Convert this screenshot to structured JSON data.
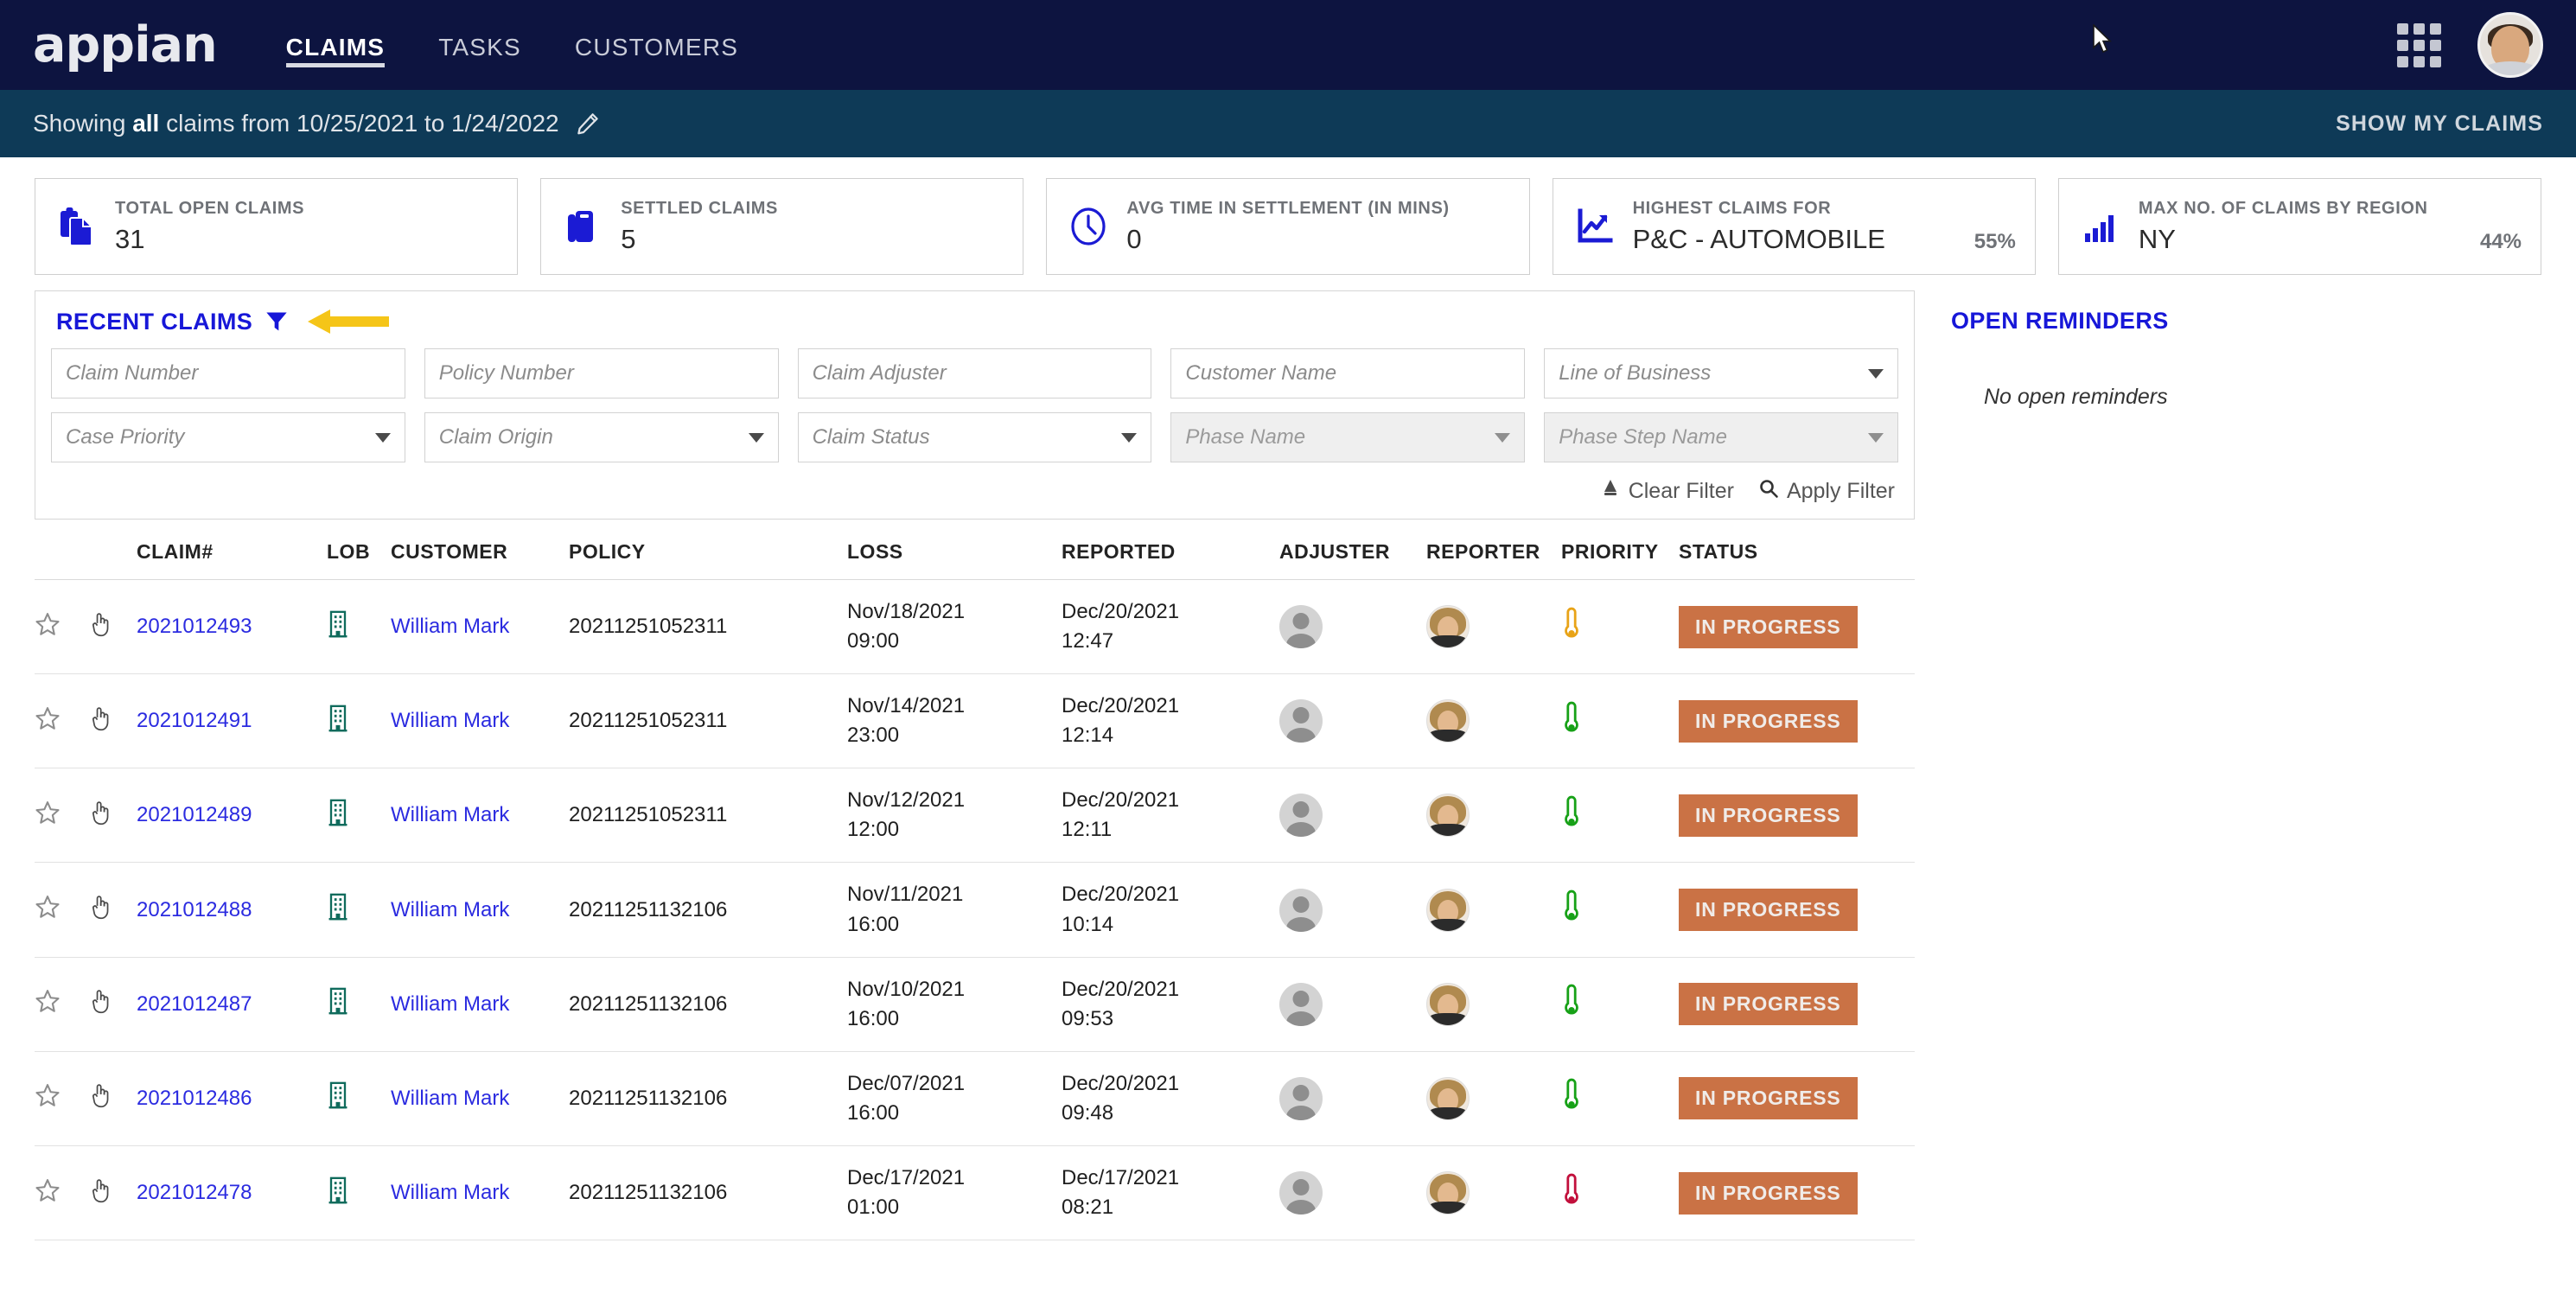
{
  "header": {
    "logo": "appian",
    "nav": [
      {
        "label": "CLAIMS",
        "active": true
      },
      {
        "label": "TASKS",
        "active": false
      },
      {
        "label": "CUSTOMERS",
        "active": false
      }
    ],
    "grid_icon": "apps-grid-icon",
    "avatar": "user-avatar"
  },
  "subheader": {
    "prefix": "Showing",
    "emphasis": "all",
    "suffix": "claims from 10/25/2021 to 1/24/2022",
    "edit_icon": "pencil-icon",
    "show_my_claims": "SHOW MY CLAIMS"
  },
  "kpis": [
    {
      "label": "TOTAL OPEN CLAIMS",
      "value": "31",
      "pct": "",
      "icon": "documents-icon"
    },
    {
      "label": "SETTLED CLAIMS",
      "value": "5",
      "pct": "",
      "icon": "briefcase-icon"
    },
    {
      "label": "AVG TIME IN SETTLEMENT (IN MINS)",
      "value": "0",
      "pct": "",
      "icon": "clock-icon"
    },
    {
      "label": "HIGHEST CLAIMS FOR",
      "value": "P&C - AUTOMOBILE",
      "pct": "55%",
      "icon": "line-chart-icon"
    },
    {
      "label": "MAX NO. OF CLAIMS BY REGION",
      "value": "NY",
      "pct": "44%",
      "icon": "bar-chart-icon"
    }
  ],
  "filter": {
    "title": "RECENT CLAIMS",
    "funnel_icon": "filter-funnel-icon",
    "row1": [
      {
        "placeholder": "Claim Number",
        "type": "text",
        "disabled": false
      },
      {
        "placeholder": "Policy Number",
        "type": "text",
        "disabled": false
      },
      {
        "placeholder": "Claim Adjuster",
        "type": "text",
        "disabled": false
      },
      {
        "placeholder": "Customer Name",
        "type": "text",
        "disabled": false
      },
      {
        "placeholder": "Line of Business",
        "type": "select",
        "disabled": false
      }
    ],
    "row2": [
      {
        "placeholder": "Case Priority",
        "type": "select",
        "disabled": false
      },
      {
        "placeholder": "Claim Origin",
        "type": "select",
        "disabled": false
      },
      {
        "placeholder": "Claim Status",
        "type": "select",
        "disabled": false
      },
      {
        "placeholder": "Phase Name",
        "type": "select",
        "disabled": true
      },
      {
        "placeholder": "Phase Step Name",
        "type": "select",
        "disabled": true
      }
    ],
    "clear_label": "Clear Filter",
    "apply_label": "Apply Filter"
  },
  "table": {
    "columns": [
      "",
      "",
      "CLAIM#",
      "LOB",
      "CUSTOMER",
      "POLICY",
      "LOSS",
      "REPORTED",
      "ADJUSTER",
      "REPORTER",
      "PRIORITY",
      "STATUS"
    ],
    "rows": [
      {
        "claim": "2021012493",
        "customer": "William Mark",
        "policy": "20211251052311",
        "loss_date": "Nov/18/2021",
        "loss_time": "09:00",
        "rep_date": "Dec/20/2021",
        "rep_time": "12:47",
        "priority_color": "#e8a317",
        "status": "IN PROGRESS"
      },
      {
        "claim": "2021012491",
        "customer": "William Mark",
        "policy": "20211251052311",
        "loss_date": "Nov/14/2021",
        "loss_time": "23:00",
        "rep_date": "Dec/20/2021",
        "rep_time": "12:14",
        "priority_color": "#17a117",
        "status": "IN PROGRESS"
      },
      {
        "claim": "2021012489",
        "customer": "William Mark",
        "policy": "20211251052311",
        "loss_date": "Nov/12/2021",
        "loss_time": "12:00",
        "rep_date": "Dec/20/2021",
        "rep_time": "12:11",
        "priority_color": "#17a117",
        "status": "IN PROGRESS"
      },
      {
        "claim": "2021012488",
        "customer": "William Mark",
        "policy": "20211251132106",
        "loss_date": "Nov/11/2021",
        "loss_time": "16:00",
        "rep_date": "Dec/20/2021",
        "rep_time": "10:14",
        "priority_color": "#17a117",
        "status": "IN PROGRESS"
      },
      {
        "claim": "2021012487",
        "customer": "William Mark",
        "policy": "20211251132106",
        "loss_date": "Nov/10/2021",
        "loss_time": "16:00",
        "rep_date": "Dec/20/2021",
        "rep_time": "09:53",
        "priority_color": "#17a117",
        "status": "IN PROGRESS"
      },
      {
        "claim": "2021012486",
        "customer": "William Mark",
        "policy": "20211251132106",
        "loss_date": "Dec/07/2021",
        "loss_time": "16:00",
        "rep_date": "Dec/20/2021",
        "rep_time": "09:48",
        "priority_color": "#17a117",
        "status": "IN PROGRESS"
      },
      {
        "claim": "2021012478",
        "customer": "William Mark",
        "policy": "20211251132106",
        "loss_date": "Dec/17/2021",
        "loss_time": "01:00",
        "rep_date": "Dec/17/2021",
        "rep_time": "08:21",
        "priority_color": "#c2103c",
        "status": "IN PROGRESS"
      }
    ]
  },
  "reminders": {
    "title": "OPEN REMINDERS",
    "empty": "No open reminders"
  },
  "colors": {
    "nav_bg": "#0d1440",
    "subheader_bg": "#0e3a57",
    "accent_blue": "#1717d8",
    "badge_orange": "#ca7245",
    "annotation_yellow": "#f5c518",
    "lob_teal": "#0f6b5c"
  }
}
